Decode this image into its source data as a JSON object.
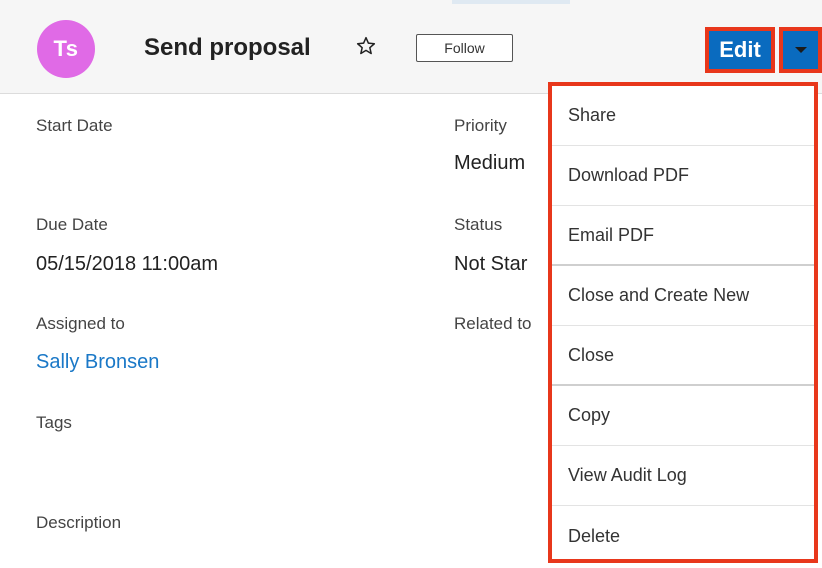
{
  "header": {
    "avatar_initials": "Ts",
    "avatar_color": "#e06ae6",
    "title": "Send proposal",
    "follow_label": "Follow",
    "edit_label": "Edit",
    "accent_color": "#0a6bbf",
    "highlight_color": "#e8371b"
  },
  "fields": {
    "start_date": {
      "label": "Start Date",
      "value": ""
    },
    "priority": {
      "label": "Priority",
      "value": "Medium"
    },
    "due_date": {
      "label": "Due Date",
      "value": "05/15/2018 11:00am"
    },
    "status": {
      "label": "Status",
      "value": "Not Star"
    },
    "assigned_to": {
      "label": "Assigned to",
      "value": "Sally Bronsen"
    },
    "related_to": {
      "label": "Related to"
    },
    "tags": {
      "label": "Tags"
    },
    "description": {
      "label": "Description"
    }
  },
  "menu": {
    "items": [
      {
        "label": "Share"
      },
      {
        "label": "Download PDF"
      },
      {
        "label": "Email PDF"
      },
      {
        "label": "Close and Create New"
      },
      {
        "label": "Close"
      },
      {
        "label": "Copy"
      },
      {
        "label": "View Audit Log"
      },
      {
        "label": "Delete"
      }
    ]
  }
}
